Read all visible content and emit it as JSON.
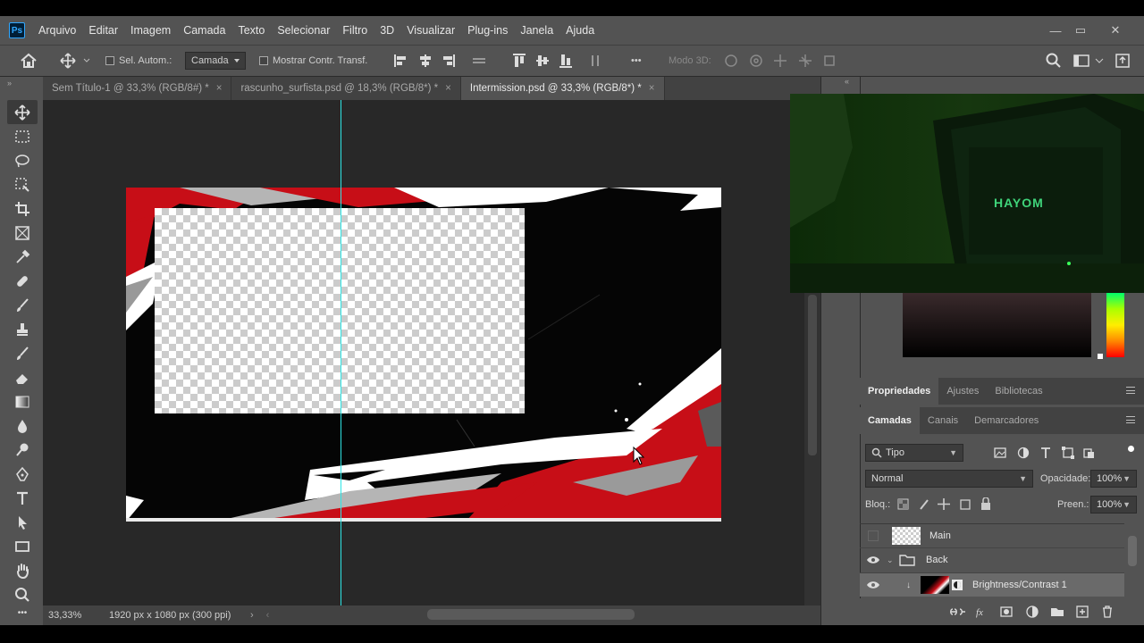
{
  "app": {
    "logo": "Ps"
  },
  "menu": [
    "Arquivo",
    "Editar",
    "Imagem",
    "Camada",
    "Texto",
    "Selecionar",
    "Filtro",
    "3D",
    "Visualizar",
    "Plug-ins",
    "Janela",
    "Ajuda"
  ],
  "window_controls": {
    "minimize": "—",
    "maximize": "▭",
    "close": "✕"
  },
  "options": {
    "auto_select_label": "Sel. Autom.:",
    "auto_select_value": "Camada",
    "show_transform_label": "Mostrar Contr. Transf.",
    "more_label": "•••",
    "mode3d_label": "Modo 3D:"
  },
  "tabs": [
    {
      "label": "Sem Título-1 @ 33,3% (RGB/8#) *",
      "close": "×"
    },
    {
      "label": "rascunho_surfista.psd @ 18,3% (RGB/8*) *",
      "close": "×"
    },
    {
      "label": "Intermission.psd @ 33,3% (RGB/8*) *",
      "close": "×"
    }
  ],
  "status": {
    "zoom": "33,33%",
    "doc_info": "1920 px x 1080 px (300 ppi)"
  },
  "webcam": {
    "case_brand": "HAYOM"
  },
  "panels": {
    "properties_tabs": [
      "Propriedades",
      "Ajustes",
      "Bibliotecas"
    ],
    "layers_tabs": [
      "Camadas",
      "Canais",
      "Demarcadores"
    ]
  },
  "layers_panel": {
    "filter_kind": "Tipo",
    "blend_mode": "Normal",
    "opacity_label": "Opacidade:",
    "opacity_value": "100%",
    "lock_label": "Bloq.:",
    "fill_label": "Preen.:",
    "fill_value": "100%"
  },
  "layers": [
    {
      "name": "Main",
      "visible": false
    },
    {
      "name": "Back",
      "visible": true,
      "type": "group"
    },
    {
      "name": "Brightness/Contrast 1",
      "visible": true,
      "type": "adjustment"
    }
  ],
  "colors": {
    "guide": "#2ee6e6",
    "accent_red": "#d40a14",
    "panel": "#535353"
  }
}
